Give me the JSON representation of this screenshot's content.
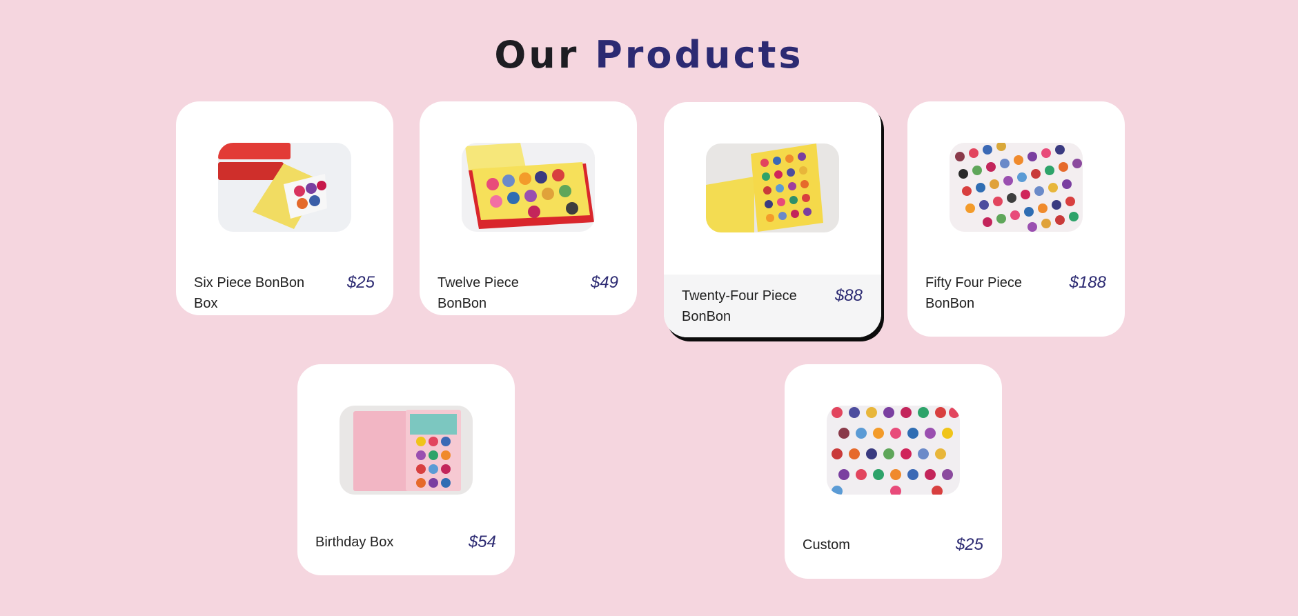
{
  "heading": {
    "part1": "Our",
    "part2": "Products"
  },
  "colors": {
    "background": "#f5d6df",
    "accent": "#2c2a72",
    "card": "#ffffff"
  },
  "products": [
    {
      "name": "Six Piece BonBon Box",
      "price": "$25",
      "image": "six-piece-box-photo"
    },
    {
      "name": "Twelve Piece BonBon",
      "price": "$49",
      "image": "twelve-piece-box-photo"
    },
    {
      "name": "Twenty-Four Piece BonBon",
      "price": "$88",
      "image": "twenty-four-piece-box-photo"
    },
    {
      "name": "Fifty Four Piece BonBon",
      "price": "$188",
      "image": "fifty-four-piece-bonbons-photo"
    },
    {
      "name": "Birthday Box",
      "price": "$54",
      "image": "birthday-box-photo"
    },
    {
      "name": "Custom",
      "price": "$25",
      "image": "custom-bonbons-photo"
    }
  ]
}
